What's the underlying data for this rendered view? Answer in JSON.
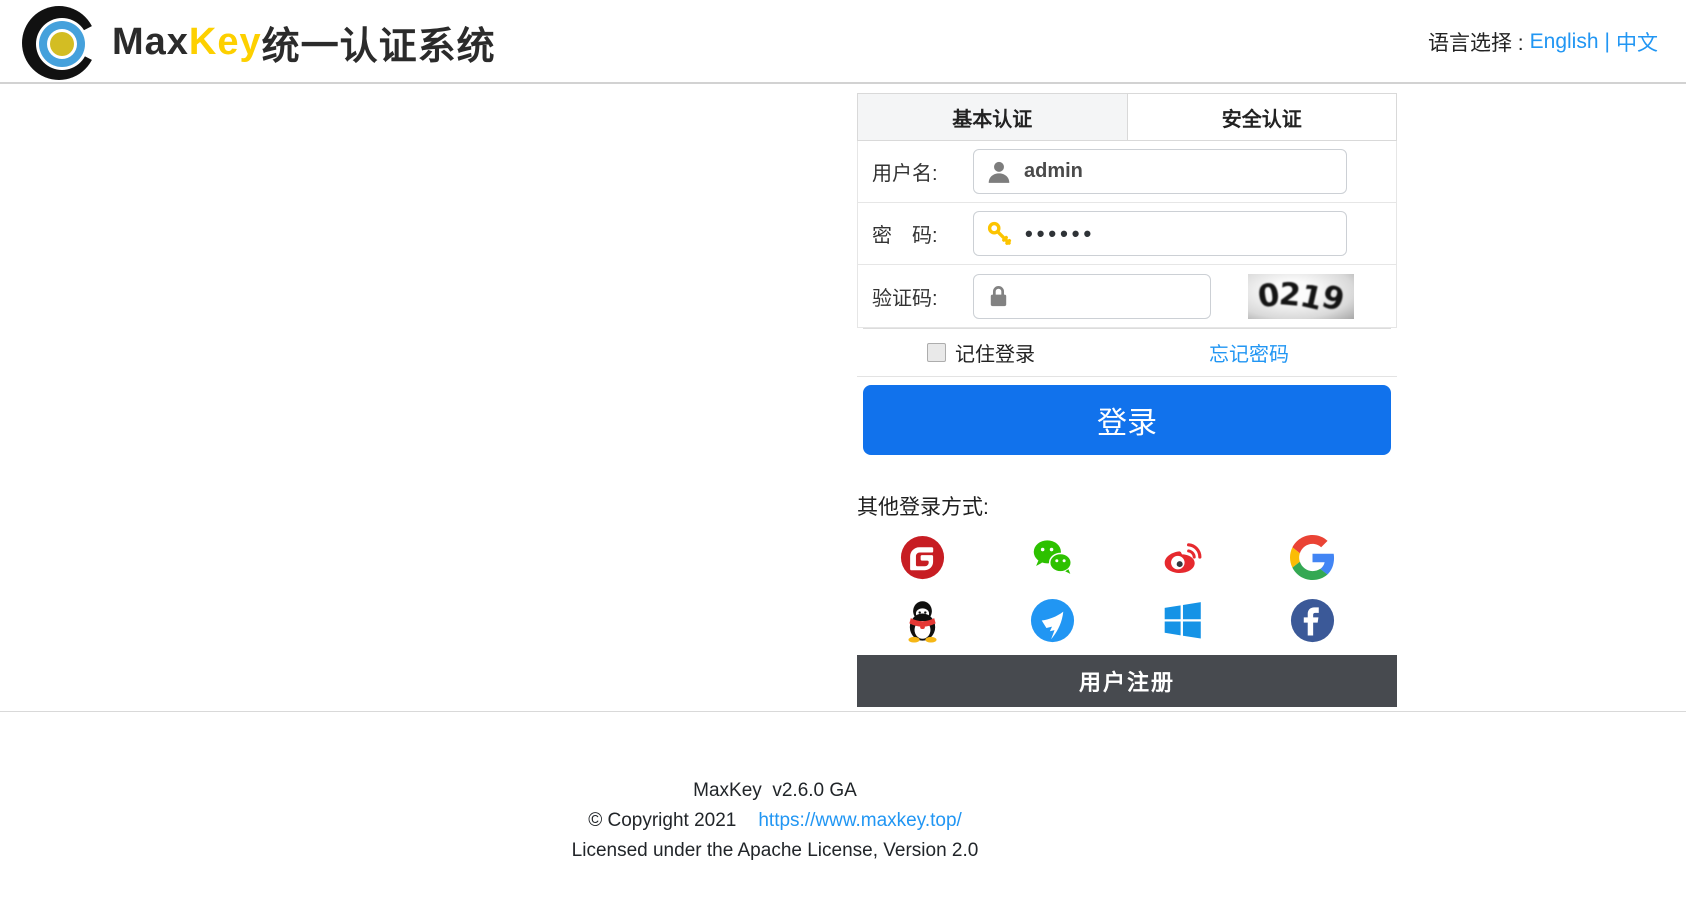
{
  "header": {
    "brand_prefix": "Max",
    "brand_highlight": "Key",
    "brand_suffix": "统一认证系统",
    "language_label": "语言选择 :",
    "language_english": "English",
    "language_separator": "|",
    "language_chinese": "中文"
  },
  "login": {
    "tabs": [
      {
        "label": "基本认证",
        "active": true
      },
      {
        "label": "安全认证",
        "active": false
      }
    ],
    "username": {
      "label": "用户名:",
      "value": "admin",
      "icon": "user-icon"
    },
    "password": {
      "label": "密　码:",
      "value": "••••••",
      "icon": "key-icon"
    },
    "captcha": {
      "label": "验证码:",
      "value": "",
      "icon": "lock-icon",
      "image_text": "0219",
      "chars": [
        "0",
        "2",
        "1",
        "9"
      ]
    },
    "remember_label": "记住登录",
    "forgot_label": "忘记密码",
    "submit_label": "登录",
    "other_methods_label": "其他登录方式:",
    "social_providers": [
      "Gitee",
      "WeChat",
      "Weibo",
      "Google",
      "QQ",
      "DingTalk",
      "Microsoft",
      "Facebook"
    ],
    "register_label": "用户注册"
  },
  "footer": {
    "version_line": "MaxKey  v2.6.0 GA",
    "copyright_prefix": "© Copyright 2021",
    "site_link": "https://www.maxkey.top/",
    "license_line": "Licensed under the Apache License, Version 2.0"
  },
  "colors": {
    "accent_blue": "#1172ec",
    "link_blue": "#2196f3",
    "brand_yellow": "#fdd000",
    "logo_blue": "#45a1dc",
    "logo_yellow": "#d3bd23",
    "register_bar_bg": "#474a4f"
  }
}
